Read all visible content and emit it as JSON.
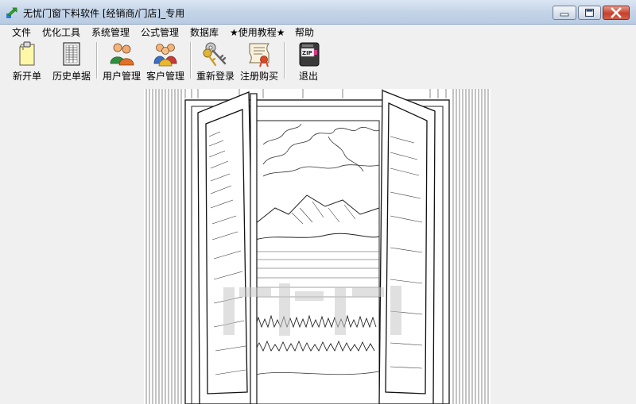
{
  "window": {
    "title": "无忧门窗下料软件 [经销商/门店]_专用",
    "icon": "green-arrow-app-icon",
    "controls": [
      "minimize-icon",
      "maximize-icon",
      "close-icon"
    ],
    "close_color": "#c7412b"
  },
  "menu": {
    "items": [
      {
        "label": "文件"
      },
      {
        "label": "优化工具"
      },
      {
        "label": "系统管理"
      },
      {
        "label": "公式管理"
      },
      {
        "label": "数据库"
      },
      {
        "label": "★使用教程★"
      },
      {
        "label": "帮助"
      }
    ]
  },
  "toolbar": {
    "buttons": [
      {
        "label": "新开单",
        "icon": "clipboard-icon"
      },
      {
        "label": "历史单据",
        "icon": "ledger-icon"
      },
      {
        "label": "用户管理",
        "icon": "users-icon"
      },
      {
        "label": "客户管理",
        "icon": "customers-icon"
      },
      {
        "label": "重新登录",
        "icon": "keys-icon"
      },
      {
        "label": "注册购买",
        "icon": "certificate-icon"
      },
      {
        "label": "退出",
        "icon": "exit-zip-icon"
      }
    ]
  },
  "main": {
    "illustration": "open-window-landscape-sketch",
    "watermark_color": "#c8c8c8"
  }
}
